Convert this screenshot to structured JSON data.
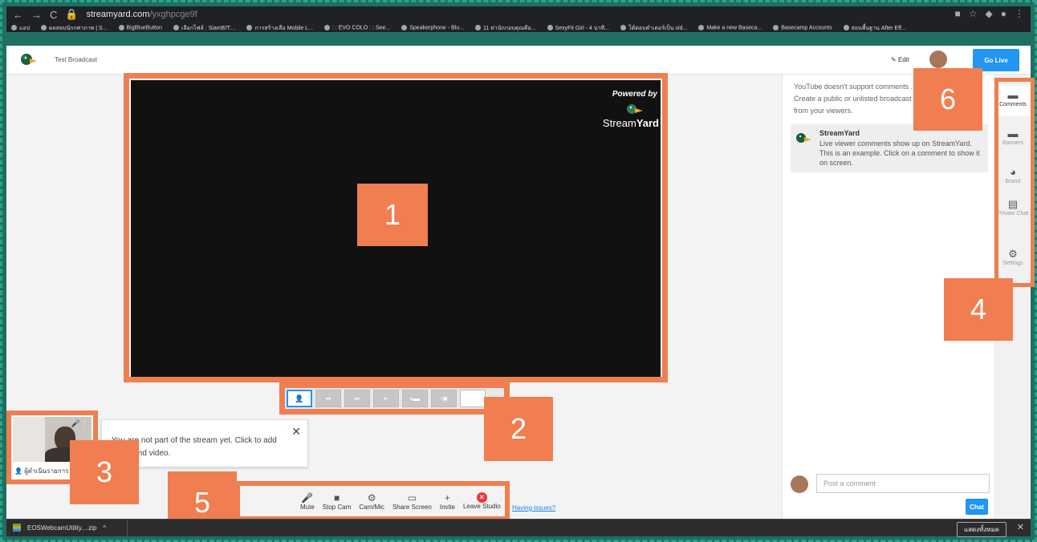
{
  "browser": {
    "url_host": "streamyard.com",
    "url_path": "/yxghpcge9f",
    "bookmarks": [
      "แอป",
      "ผลสอบนักกศาภาพ | S...",
      "BigBlueButton",
      "เลือกไฟล์ : SiamBIT:...",
      "การสร้างเลือ Mobile L...",
      ": : EVO COLO : : See...",
      "Speakerphone - Blu...",
      "11 ท่านักกอบคุณคือ...",
      "SexyFit Girl - 4 นาที...",
      "โต้ตอบคำเตอร์เป็น vid...",
      "Make a new Baseca...",
      "Basecamp Accounts",
      "สอนพื้นฐาน After Eff..."
    ]
  },
  "header": {
    "title": "Test Broadcast",
    "edit_label": "Edit",
    "go_live_label": "Go Live"
  },
  "stage": {
    "powered_by": "Powered by",
    "brand_light": "Stream",
    "brand_bold": "Yard"
  },
  "badges": {
    "b1": "1",
    "b2": "2",
    "b3": "3",
    "b4": "4",
    "b5": "5",
    "b6": "6"
  },
  "notice": {
    "text": "You are not part of the stream yet. Click to add audio and video.",
    "close": "✕"
  },
  "camera": {
    "name_label": "ผู้ดำเนินรายการ"
  },
  "controls": [
    {
      "icon": "🎤",
      "label": "Mute"
    },
    {
      "icon": "■",
      "label": "Stop Cam"
    },
    {
      "icon": "⚙",
      "label": "Cam/Mic"
    },
    {
      "icon": "▭",
      "label": "Share Screen"
    },
    {
      "icon": "+",
      "label": "Invite"
    },
    {
      "icon": "✕",
      "label": "Leave Studio"
    }
  ],
  "having_issues": "Having issues?",
  "comments": {
    "yt_message": "YouTube doesn't support comments ... Create a public or unlisted broadcast ... from your viewers.",
    "sample_name": "StreamYard",
    "sample_text": "Live viewer comments show up on StreamYard. This is an example. Click on a comment to show it on screen.",
    "post_placeholder": "Post a comment",
    "chat_button": "Chat"
  },
  "rail": [
    {
      "icon": "▬",
      "label": "Comments"
    },
    {
      "icon": "▬",
      "label": "Banners"
    },
    {
      "icon": "◕",
      "label": "Brand"
    },
    {
      "icon": "▤",
      "label": "Private Chat"
    },
    {
      "icon": "⚙",
      "label": "Settings"
    }
  ],
  "download_bar": {
    "file": "EOSWebcamUtility....zip",
    "show_all": "แสดงทั้งหมด",
    "close": "✕"
  },
  "colors": {
    "accent_orange": "#f07e50",
    "primary_blue": "#2196f3"
  }
}
